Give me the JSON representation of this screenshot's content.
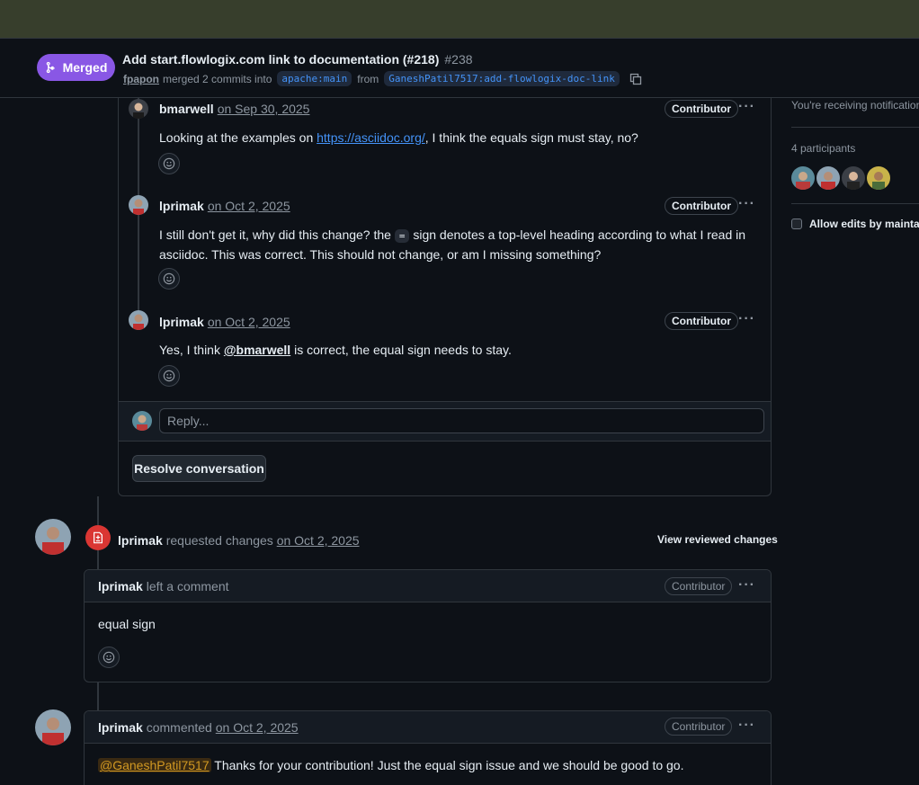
{
  "header": {
    "merged_label": "Merged",
    "title": "Add start.flowlogix.com link to documentation (#218)",
    "number": "#238",
    "author": "fpapon",
    "merged_text": "merged 2 commits into",
    "base_branch": "apache:main",
    "from_text": "from",
    "head_branch": "GaneshPatil7517:add-flowlogix-doc-link"
  },
  "sidebar": {
    "notifications_text": "You're receiving notifications",
    "participants_label": "4 participants",
    "allow_edits_label": "Allow edits by maintainers"
  },
  "thread": {
    "comments": [
      {
        "author": "bmarwell",
        "date": "on Sep 30, 2025",
        "badge": "Contributor",
        "body_pre": "Looking at the examples on ",
        "link": "https://asciidoc.org/",
        "body_post": ", I think the equals sign must stay, no?"
      },
      {
        "author": "lprimak",
        "date": "on Oct 2, 2025",
        "badge": "Contributor",
        "body_pre": "I still don't get it, why did this change? the ",
        "code": "=",
        "body_post": " sign denotes a top-level heading according to what I read in",
        "body_line2": "asciidoc. This was correct. This should not change, or am I missing something?"
      },
      {
        "author": "lprimak",
        "date": "on Oct 2, 2025",
        "badge": "Contributor",
        "body_pre": "Yes, I think ",
        "mention": "@bmarwell",
        "body_post": " is correct, the equal sign needs to stay."
      }
    ],
    "reply_placeholder": "Reply...",
    "resolve_label": "Resolve conversation"
  },
  "review": {
    "author": "lprimak",
    "action": "requested changes",
    "date": "on Oct 2, 2025",
    "view_changes_label": "View reviewed changes",
    "card": {
      "author": "lprimak",
      "action": "left a comment",
      "badge": "Contributor",
      "body": "equal sign"
    }
  },
  "comment": {
    "author": "lprimak",
    "action": "commented",
    "date": "on Oct 2, 2025",
    "badge": "Contributor",
    "mention": "@GaneshPatil7517",
    "body_post": " Thanks for your contribution! Just the equal sign issue and we should be good to go."
  },
  "colors": {
    "merged": "#8957e5",
    "changes_requested": "#da3633",
    "link": "#4493f8"
  }
}
